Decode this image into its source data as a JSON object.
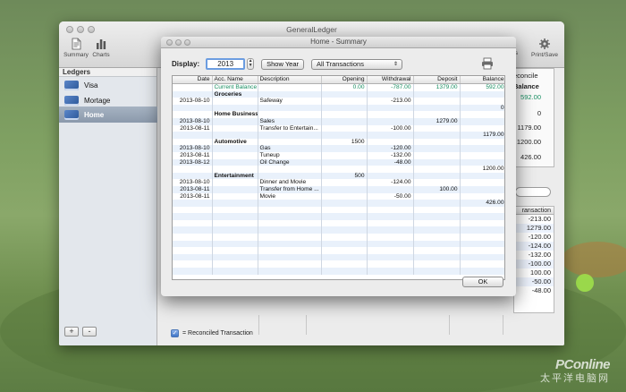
{
  "main_window": {
    "title": "GeneralLedger",
    "toolbar": {
      "summary_label": "Summary",
      "charts_label": "Charts",
      "print_label": "Print/Save",
      "options_label": "ions"
    },
    "sidebar": {
      "header": "Ledgers",
      "items": [
        {
          "label": "Visa",
          "selected": false
        },
        {
          "label": "Mortage",
          "selected": false
        },
        {
          "label": "Home",
          "selected": true
        }
      ],
      "add_label": "+",
      "remove_label": "-"
    },
    "reconcile_legend": "= Reconciled Transaction",
    "side_panel": {
      "reconcile_label": "econcile",
      "balance_header": "Balance",
      "balances": [
        "592.00",
        "0",
        "1179.00",
        "1200.00",
        "426.00"
      ],
      "transaction_header": "ransaction",
      "transactions": [
        "-213.00",
        "1279.00",
        "-120.00",
        "-124.00",
        "-132.00",
        "-100.00",
        "100.00",
        "-50.00",
        "-48.00"
      ]
    }
  },
  "summary_sheet": {
    "title": "Home - Summary",
    "display_label": "Display:",
    "year_value": "2013",
    "show_year_button": "Show Year",
    "filter_selected": "All Transactions",
    "ok_button": "OK",
    "columns": [
      "Date",
      "Acc. Name",
      "Description",
      "Opening",
      "Withdrawal",
      "Deposit",
      "Balance"
    ],
    "rows": [
      {
        "date": "",
        "acc": "Current Balance",
        "desc": "",
        "opening": "0.00",
        "withdrawal": "-787.00",
        "deposit": "1379.00",
        "balance": "592.00",
        "style": "green"
      },
      {
        "date": "",
        "acc": "Groceries",
        "desc": "",
        "opening": "",
        "withdrawal": "",
        "deposit": "",
        "balance": "",
        "style": "bold"
      },
      {
        "date": "2013-08-10",
        "acc": "",
        "desc": "Safeway",
        "opening": "",
        "withdrawal": "-213.00",
        "deposit": "",
        "balance": "",
        "style": ""
      },
      {
        "date": "",
        "acc": "",
        "desc": "",
        "opening": "",
        "withdrawal": "",
        "deposit": "",
        "balance": "0",
        "style": ""
      },
      {
        "date": "",
        "acc": "Home Business",
        "desc": "",
        "opening": "",
        "withdrawal": "",
        "deposit": "",
        "balance": "",
        "style": "bold"
      },
      {
        "date": "2013-08-10",
        "acc": "",
        "desc": "Sales",
        "opening": "",
        "withdrawal": "",
        "deposit": "1279.00",
        "balance": "",
        "style": ""
      },
      {
        "date": "2013-08-11",
        "acc": "",
        "desc": "Transfer to Entertain...",
        "opening": "",
        "withdrawal": "-100.00",
        "deposit": "",
        "balance": "",
        "style": ""
      },
      {
        "date": "",
        "acc": "",
        "desc": "",
        "opening": "",
        "withdrawal": "",
        "deposit": "",
        "balance": "1179.00",
        "style": ""
      },
      {
        "date": "",
        "acc": "Automotive",
        "desc": "",
        "opening": "1500",
        "withdrawal": "",
        "deposit": "",
        "balance": "",
        "style": "bold"
      },
      {
        "date": "2013-08-10",
        "acc": "",
        "desc": "Gas",
        "opening": "",
        "withdrawal": "-120.00",
        "deposit": "",
        "balance": "",
        "style": ""
      },
      {
        "date": "2013-08-11",
        "acc": "",
        "desc": "Tuneup",
        "opening": "",
        "withdrawal": "-132.00",
        "deposit": "",
        "balance": "",
        "style": ""
      },
      {
        "date": "2013-08-12",
        "acc": "",
        "desc": "Oil Change",
        "opening": "",
        "withdrawal": "-48.00",
        "deposit": "",
        "balance": "",
        "style": ""
      },
      {
        "date": "",
        "acc": "",
        "desc": "",
        "opening": "",
        "withdrawal": "",
        "deposit": "",
        "balance": "1200.00",
        "style": ""
      },
      {
        "date": "",
        "acc": "Entertainment",
        "desc": "",
        "opening": "500",
        "withdrawal": "",
        "deposit": "",
        "balance": "",
        "style": "bold"
      },
      {
        "date": "2013-08-10",
        "acc": "",
        "desc": "Dinner and Movie",
        "opening": "",
        "withdrawal": "-124.00",
        "deposit": "",
        "balance": "",
        "style": ""
      },
      {
        "date": "2013-08-11",
        "acc": "",
        "desc": "Transfer from Home ...",
        "opening": "",
        "withdrawal": "",
        "deposit": "100.00",
        "balance": "",
        "style": ""
      },
      {
        "date": "2013-08-11",
        "acc": "",
        "desc": "Movie",
        "opening": "",
        "withdrawal": "-50.00",
        "deposit": "",
        "balance": "",
        "style": ""
      },
      {
        "date": "",
        "acc": "",
        "desc": "",
        "opening": "",
        "withdrawal": "",
        "deposit": "",
        "balance": "426.00",
        "style": ""
      }
    ],
    "empty_row_count": 10
  },
  "watermark": {
    "brand": "PConline",
    "tagline": "太平洋电脑网"
  },
  "colors": {
    "green_text": "#188f62",
    "selection": "#8b99ab",
    "focus_ring": "#6c9de0"
  }
}
